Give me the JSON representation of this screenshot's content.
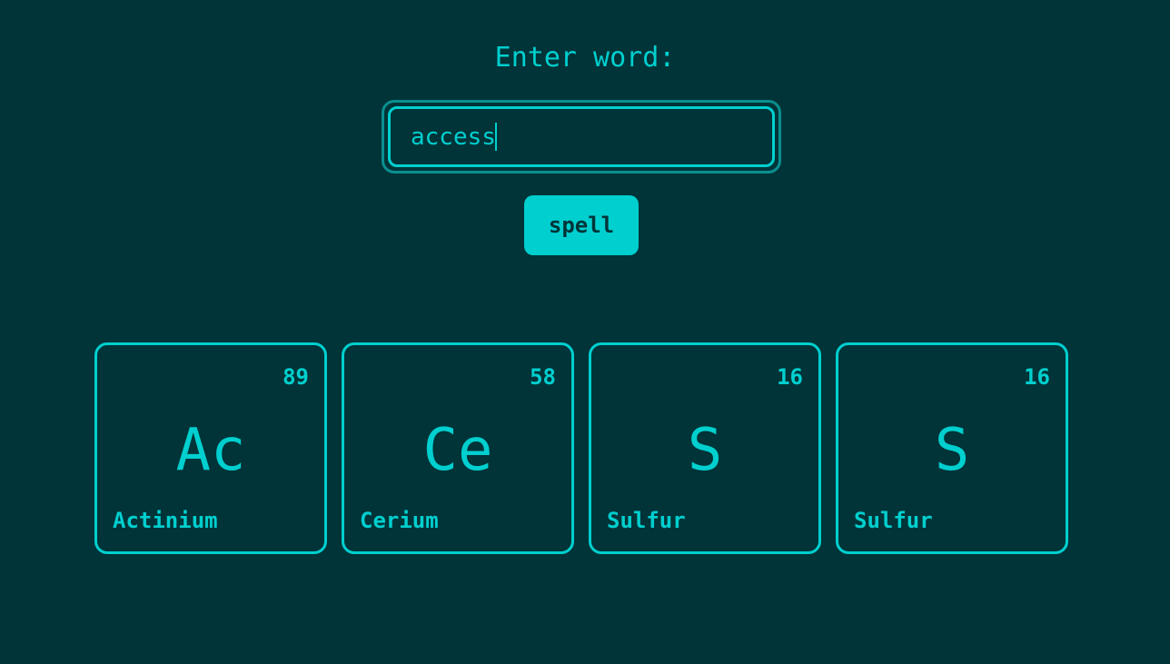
{
  "prompt": {
    "label": "Enter word:"
  },
  "word_input": {
    "value": "access",
    "placeholder": ""
  },
  "spell_button": {
    "label": "spell"
  },
  "tiles": [
    {
      "number": "89",
      "symbol": "Ac",
      "name": "Actinium"
    },
    {
      "number": "58",
      "symbol": "Ce",
      "name": "Cerium"
    },
    {
      "number": "16",
      "symbol": "S",
      "name": "Sulfur"
    },
    {
      "number": "16",
      "symbol": "S",
      "name": "Sulfur"
    }
  ],
  "colors": {
    "background": "#003438",
    "accent": "#00cfcf",
    "input_ring": "#0a8f90"
  }
}
